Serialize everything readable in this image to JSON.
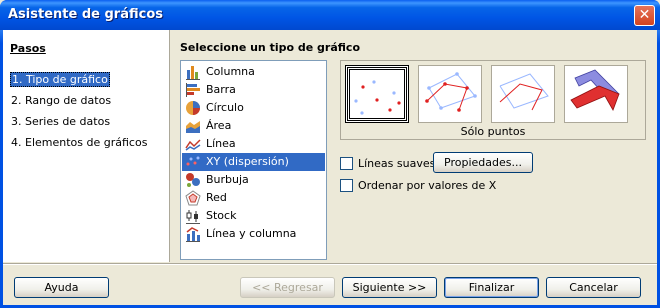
{
  "window": {
    "title": "Asistente de gráficos"
  },
  "steps": {
    "title": "Pasos",
    "items": [
      {
        "label": "1. Tipo de gráfico"
      },
      {
        "label": "2. Rango de datos"
      },
      {
        "label": "3. Series de datos"
      },
      {
        "label": "4. Elementos de gráficos"
      }
    ]
  },
  "main": {
    "title": "Seleccione un tipo de gráfico",
    "chart_types": [
      {
        "label": "Columna",
        "icon": "column-chart-icon"
      },
      {
        "label": "Barra",
        "icon": "bar-chart-icon"
      },
      {
        "label": "Círculo",
        "icon": "pie-chart-icon"
      },
      {
        "label": "Área",
        "icon": "area-chart-icon"
      },
      {
        "label": "Línea",
        "icon": "line-chart-icon"
      },
      {
        "label": "XY (dispersión)",
        "icon": "xy-scatter-icon",
        "selected": true
      },
      {
        "label": "Burbuja",
        "icon": "bubble-chart-icon"
      },
      {
        "label": "Red",
        "icon": "net-chart-icon"
      },
      {
        "label": "Stock",
        "icon": "stock-chart-icon"
      },
      {
        "label": "Línea y columna",
        "icon": "line-column-chart-icon"
      }
    ],
    "variant_label": "Sólo puntos",
    "options": {
      "smooth_lines": "Líneas suaves",
      "properties_button": "Propiedades...",
      "sort_by_x": "Ordenar por valores de X"
    }
  },
  "footer": {
    "help": "Ayuda",
    "back": "<< Regresar",
    "next": "Siguiente >>",
    "finish": "Finalizar",
    "cancel": "Cancelar"
  },
  "colors": {
    "selection": "#316AC5",
    "titlebar": "#0055E5"
  }
}
